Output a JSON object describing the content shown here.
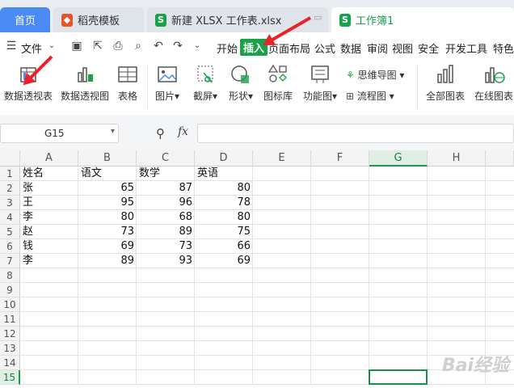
{
  "tabs": [
    {
      "label": "首页"
    },
    {
      "label": "稻壳模板"
    },
    {
      "label": "新建 XLSX 工作表.xlsx"
    },
    {
      "label": "工作簿1"
    }
  ],
  "menu": {
    "file_label": "文件",
    "items": [
      "开始",
      "插入",
      "页面布局",
      "公式",
      "数据",
      "审阅",
      "视图",
      "安全",
      "开发工具",
      "特色"
    ]
  },
  "ribbon": {
    "buttons": [
      "数据透视表",
      "数据透视图",
      "表格",
      "图片",
      "截屏",
      "形状",
      "图标库",
      "功能图",
      "全部图表",
      "在线图表"
    ],
    "small": [
      "思维导图",
      "流程图"
    ]
  },
  "formula_bar": {
    "cell_ref": "G15",
    "fx_label": "fx",
    "value": ""
  },
  "sheet": {
    "columns": [
      "A",
      "B",
      "C",
      "D",
      "E",
      "F",
      "G",
      "H"
    ],
    "rows": [
      "1",
      "2",
      "3",
      "4",
      "5",
      "6",
      "7",
      "8",
      "9",
      "10",
      "11",
      "12",
      "13",
      "14",
      "15"
    ],
    "selected_column": "G",
    "selected_row": "15",
    "header": [
      "姓名",
      "语文",
      "数学",
      "英语"
    ],
    "data": [
      [
        "张",
        "65",
        "87",
        "80"
      ],
      [
        "王",
        "95",
        "96",
        "78"
      ],
      [
        "李",
        "80",
        "68",
        "80"
      ],
      [
        "赵",
        "73",
        "89",
        "75"
      ],
      [
        "钱",
        "69",
        "73",
        "66"
      ],
      [
        "李",
        "89",
        "93",
        "69"
      ]
    ]
  },
  "watermark": "Bai经验",
  "colors": {
    "accent_green": "#1a9d4f",
    "home_tab_blue": "#4a8af4",
    "arrow_red": "#e8232a"
  }
}
